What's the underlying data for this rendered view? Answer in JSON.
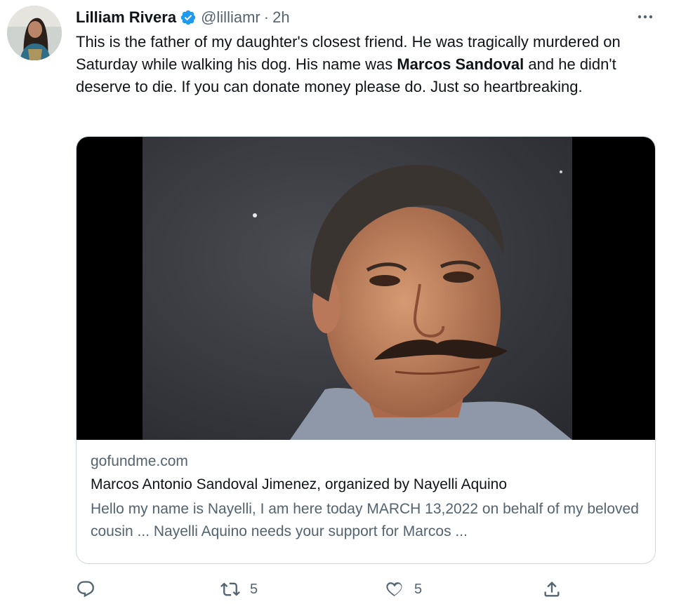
{
  "tweet": {
    "author_name": "Lilliam Rivera",
    "handle": "@lilliamr",
    "separator": "·",
    "time": "2h",
    "text_part1": "This is the father of my daughter's closest friend. He was tragically murdered on Saturday while walking his dog. His name was ",
    "text_bold": "Marcos Sandoval",
    "text_part2": " and he didn't deserve to die. If you can donate money please do. Just so heartbreaking."
  },
  "card": {
    "domain": "gofundme.com",
    "title": "Marcos Antonio Sandoval Jimenez, organized by Nayelli Aquino",
    "description": "Hello my name is Nayelli, I am here today MARCH 13,2022 on behalf of my beloved cousin ... Nayelli Aquino needs your support for Marcos ..."
  },
  "actions": {
    "reply_count": "",
    "retweet_count": "5",
    "like_count": "5"
  },
  "colors": {
    "verified": "#1d9bf0",
    "secondary_text": "#536471",
    "primary_text": "#0f1419",
    "border": "#cfd9de"
  },
  "icons": [
    "verified-badge-icon",
    "more-options-icon",
    "reply-icon",
    "retweet-icon",
    "like-icon",
    "share-icon"
  ]
}
